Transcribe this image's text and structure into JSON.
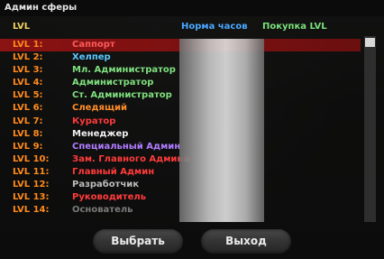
{
  "window": {
    "title": "Админ сферы"
  },
  "columns": {
    "lvl": "LVL",
    "hours": "Норма часов",
    "buy": "Покупка LVL"
  },
  "rows": [
    {
      "lvl": "LVL 1:",
      "name": "Саппорт",
      "color": "#ff5a5a",
      "selected": true
    },
    {
      "lvl": "LVL 2:",
      "name": "Хелпер",
      "color": "#59c8ff"
    },
    {
      "lvl": "LVL 3:",
      "name": "Мл. Администратор",
      "color": "#7fe07f"
    },
    {
      "lvl": "LVL 4:",
      "name": "Администратор",
      "color": "#7fe07f"
    },
    {
      "lvl": "LVL 5:",
      "name": "Ст. Администратор",
      "color": "#7fe07f"
    },
    {
      "lvl": "LVL 6:",
      "name": "Следящий",
      "color": "#ff8c28"
    },
    {
      "lvl": "LVL 7:",
      "name": "Куратор",
      "color": "#ff3b3b"
    },
    {
      "lvl": "LVL 8:",
      "name": "Менеджер",
      "color": "#f0f0f0"
    },
    {
      "lvl": "LVL 9:",
      "name": "Специальный Админ",
      "color": "#b07cff"
    },
    {
      "lvl": "LVL 10:",
      "name": "Зам. Главного Админа",
      "color": "#ff3b3b"
    },
    {
      "lvl": "LVL 11:",
      "name": "Главный Админ",
      "color": "#ff3b3b"
    },
    {
      "lvl": "LVL 12:",
      "name": "Разработчик",
      "color": "#bdbdbd"
    },
    {
      "lvl": "LVL 13:",
      "name": "Руководитель",
      "color": "#ff3b3b"
    },
    {
      "lvl": "LVL 14:",
      "name": "Основатель",
      "color": "#7a7a7a"
    }
  ],
  "lvl_color": "#ff8a1c",
  "buttons": {
    "select": "Выбрать",
    "exit": "Выход"
  }
}
